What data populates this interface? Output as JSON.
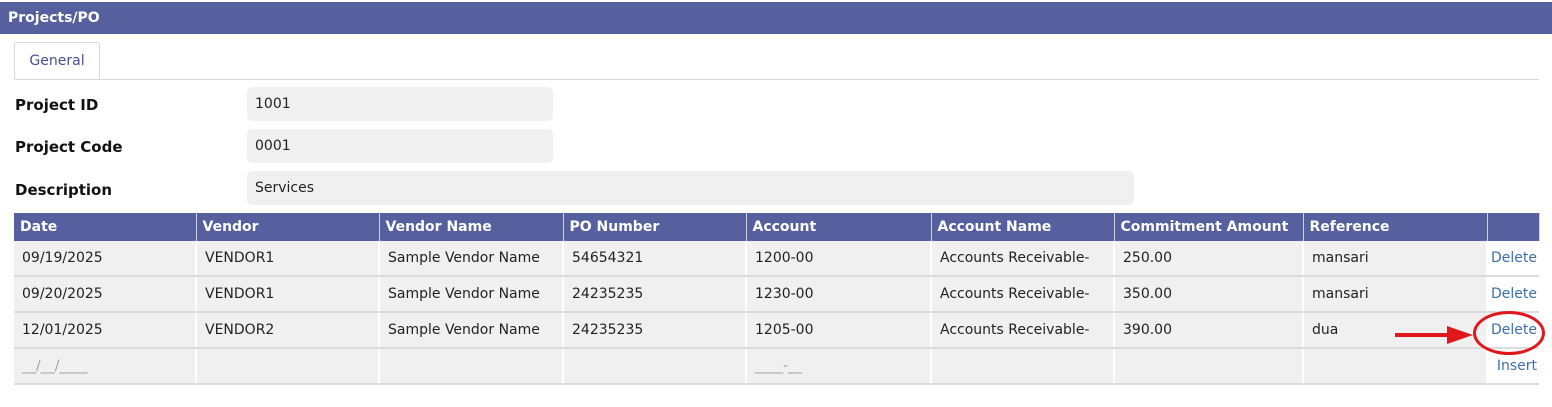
{
  "window": {
    "title": "Projects/PO"
  },
  "tabs": [
    {
      "label": "General",
      "active": true
    }
  ],
  "form": {
    "project_id": {
      "label": "Project ID",
      "value": "1001"
    },
    "project_code": {
      "label": "Project Code",
      "value": "0001"
    },
    "description": {
      "label": "Description",
      "value": "Services"
    }
  },
  "grid": {
    "columns": [
      "Date",
      "Vendor",
      "Vendor Name",
      "PO Number",
      "Account",
      "Account Name",
      "Commitment Amount",
      "Reference",
      ""
    ],
    "rows": [
      {
        "date": "09/19/2025",
        "vendor": "VENDOR1",
        "vendor_name": "Sample Vendor Name",
        "po_number": "54654321",
        "account": "1200-00",
        "account_name": "Accounts Receivable-",
        "commitment_amount": "250.00",
        "reference": "mansari",
        "action": "Delete"
      },
      {
        "date": "09/20/2025",
        "vendor": "VENDOR1",
        "vendor_name": "Sample Vendor Name",
        "po_number": "24235235",
        "account": "1230-00",
        "account_name": "Accounts Receivable-",
        "commitment_amount": "350.00",
        "reference": "mansari",
        "action": "Delete"
      },
      {
        "date": "12/01/2025",
        "vendor": "VENDOR2",
        "vendor_name": "Sample Vendor Name",
        "po_number": "24235235",
        "account": "1205-00",
        "account_name": "Accounts Receivable-",
        "commitment_amount": "390.00",
        "reference": "dua",
        "action": "Delete"
      }
    ],
    "new_row": {
      "date_mask": "__/__/____",
      "account_mask": "____-__",
      "action": "Insert"
    }
  },
  "annotation": {
    "color": "#e0181c",
    "icon": "red-arrow-icon",
    "highlight": "red-circle-highlight"
  },
  "colors": {
    "header": "#56609e",
    "link": "#3d6fb0",
    "field_bg": "#f0f0f0"
  }
}
